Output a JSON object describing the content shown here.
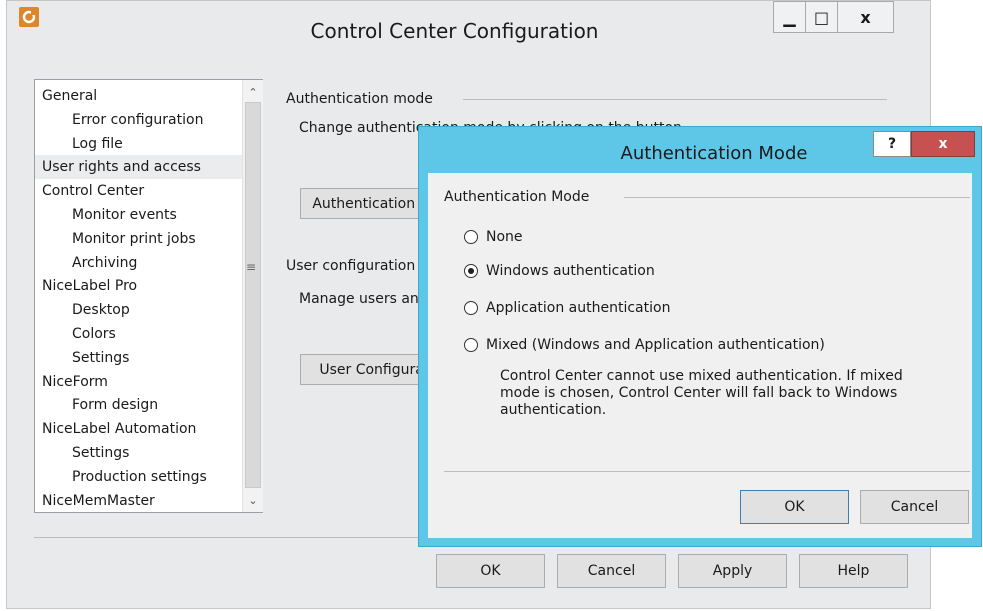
{
  "window": {
    "title": "Control Center Configuration",
    "minimize": "▁",
    "maximize": "□",
    "close": "x"
  },
  "tree": [
    {
      "label": "General",
      "level": 0
    },
    {
      "label": "Error configuration",
      "level": 1
    },
    {
      "label": "Log file",
      "level": 1
    },
    {
      "label": "User rights and access",
      "level": 0,
      "selected": true
    },
    {
      "label": "Control Center",
      "level": 0
    },
    {
      "label": "Monitor events",
      "level": 1
    },
    {
      "label": "Monitor print jobs",
      "level": 1
    },
    {
      "label": "Archiving",
      "level": 1
    },
    {
      "label": "NiceLabel Pro",
      "level": 0
    },
    {
      "label": "Desktop",
      "level": 1
    },
    {
      "label": "Colors",
      "level": 1
    },
    {
      "label": "Settings",
      "level": 1
    },
    {
      "label": "NiceForm",
      "level": 0
    },
    {
      "label": "Form design",
      "level": 1
    },
    {
      "label": "NiceLabel Automation",
      "level": 0
    },
    {
      "label": "Settings",
      "level": 1
    },
    {
      "label": "Production settings",
      "level": 1
    },
    {
      "label": "NiceMemMaster",
      "level": 0
    }
  ],
  "content": {
    "auth_section": "Authentication mode",
    "auth_desc": "Change authentication mode by clicking on the button.",
    "auth_button": "Authentication Mode",
    "user_section": "User configuration",
    "user_desc": "Manage users and groups",
    "user_button": "User Configuration"
  },
  "footer": {
    "ok": "OK",
    "cancel": "Cancel",
    "apply": "Apply",
    "help": "Help"
  },
  "dialog": {
    "title": "Authentication Mode",
    "help": "?",
    "close": "x",
    "group_label": "Authentication Mode",
    "options": [
      {
        "label": "None",
        "selected": false
      },
      {
        "label": "Windows authentication",
        "selected": true
      },
      {
        "label": "Application authentication",
        "selected": false
      },
      {
        "label": "Mixed (Windows and Application authentication)",
        "selected": false
      }
    ],
    "mixed_note": "Control Center cannot use mixed authentication. If mixed mode is chosen, Control Center will fall back to Windows authentication.",
    "ok": "OK",
    "cancel": "Cancel"
  },
  "colors": {
    "dialog_frame": "#5ec7e8",
    "close_red": "#c75050",
    "app_icon": "#e0862a"
  }
}
